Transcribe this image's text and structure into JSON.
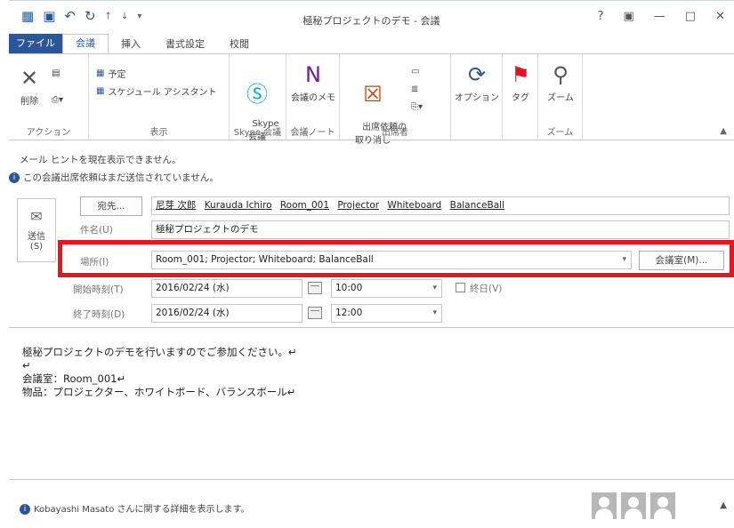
{
  "window": {
    "title": "極秘プロジェクトのデモ - 会議",
    "controls": [
      "?",
      "▣",
      "—",
      "□",
      "✕"
    ]
  },
  "tabs": [
    "ファイル",
    "会議",
    "挿入",
    "書式設定",
    "校閲"
  ],
  "ribbon": {
    "actions": {
      "delete": "削除",
      "label": "アクション"
    },
    "show": {
      "appointment": "予定",
      "scheduling_assistant": "スケジュール アシスタント",
      "label": "表示"
    },
    "skype": {
      "button": "Skype\n会議",
      "label": "Skype 会議"
    },
    "onenote": {
      "button": "会議のメモ",
      "label": "会議ノート"
    },
    "attendees": {
      "cancel": "出席依頼の\n取り消し",
      "label": "出席者"
    },
    "options": {
      "button": "オプション"
    },
    "tags": {
      "button": "タグ"
    },
    "zoom": {
      "button": "ズーム",
      "label": "ズーム"
    }
  },
  "info": {
    "mail_tips": "メール ヒントを現在表示できません。",
    "not_sent": "この会議出席依頼はまだ送信されていません。"
  },
  "send": {
    "label": "送信\n(S)"
  },
  "form": {
    "to_button": "宛先...",
    "attendees": [
      "尼芽 次郎",
      "Kurauda Ichiro",
      "Room_001",
      "Projector",
      "Whiteboard",
      "BalanceBall"
    ],
    "subject_label": "件名(U)",
    "subject": "極秘プロジェクトのデモ",
    "location_label": "場所(I)",
    "location": "Room_001; Projector; Whiteboard; BalanceBall",
    "rooms_button": "会議室(M)...",
    "start_label": "開始時刻(T)",
    "start_date": "2016/02/24 (水)",
    "start_time": "10:00",
    "allday_label": "終日(V)",
    "end_label": "終了時刻(D)",
    "end_date": "2016/02/24 (水)",
    "end_time": "12:00"
  },
  "body": {
    "line1": "極秘プロジェクトのデモを行いますのでご参加ください。↵",
    "line2": "↵",
    "line3": "会議室：Room_001↵",
    "line4": "物品：プロジェクター、ホワイトボード、バランスボール↵"
  },
  "people": {
    "info": "Kobayashi Masato さんに関する詳細を表示します。"
  },
  "colors": {
    "accent": "#2b579a",
    "highlight": "#e8151b"
  }
}
